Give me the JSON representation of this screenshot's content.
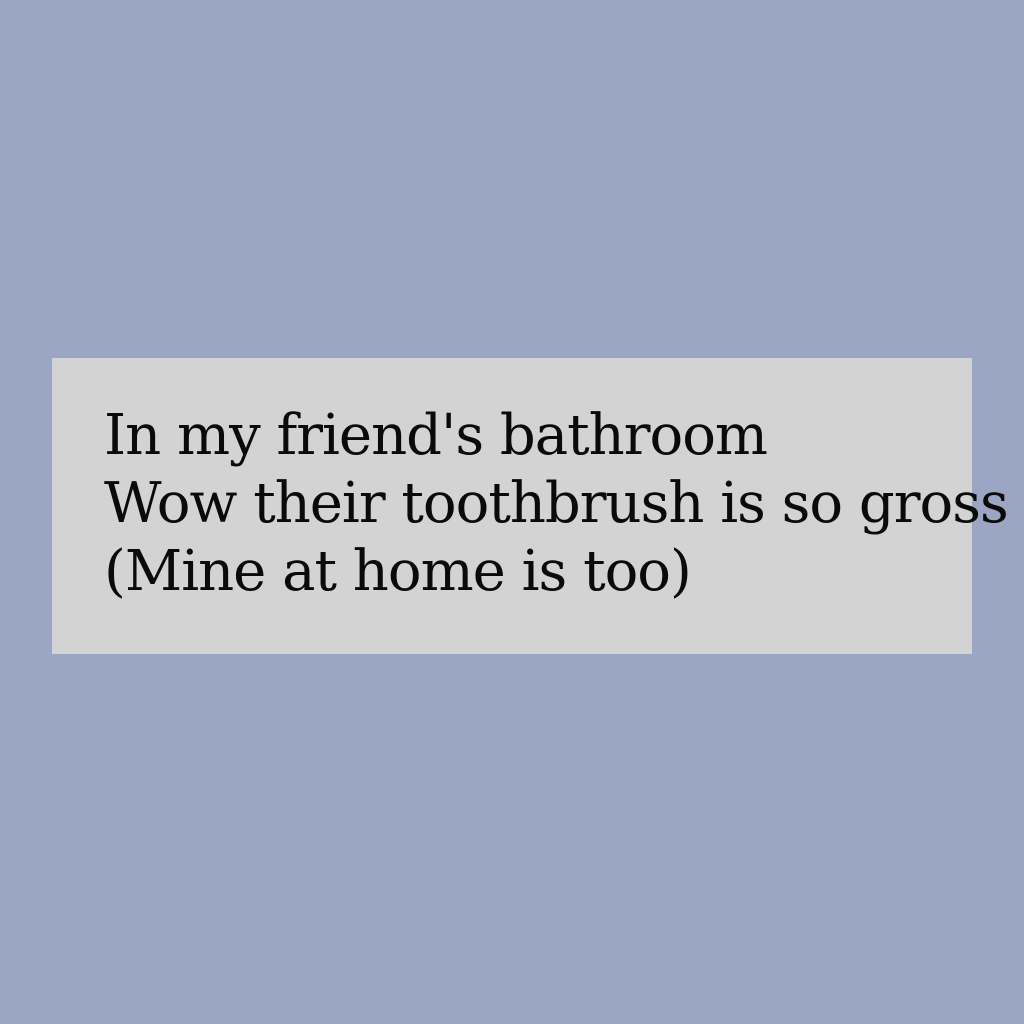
{
  "background_color": "#9ba6c4",
  "card": {
    "background_color": "#d3d3d3",
    "text_color": "#0a0a0a",
    "lines": [
      "In my friend's bathroom",
      "Wow their toothbrush is so gross",
      "(Mine at home is too)"
    ]
  }
}
